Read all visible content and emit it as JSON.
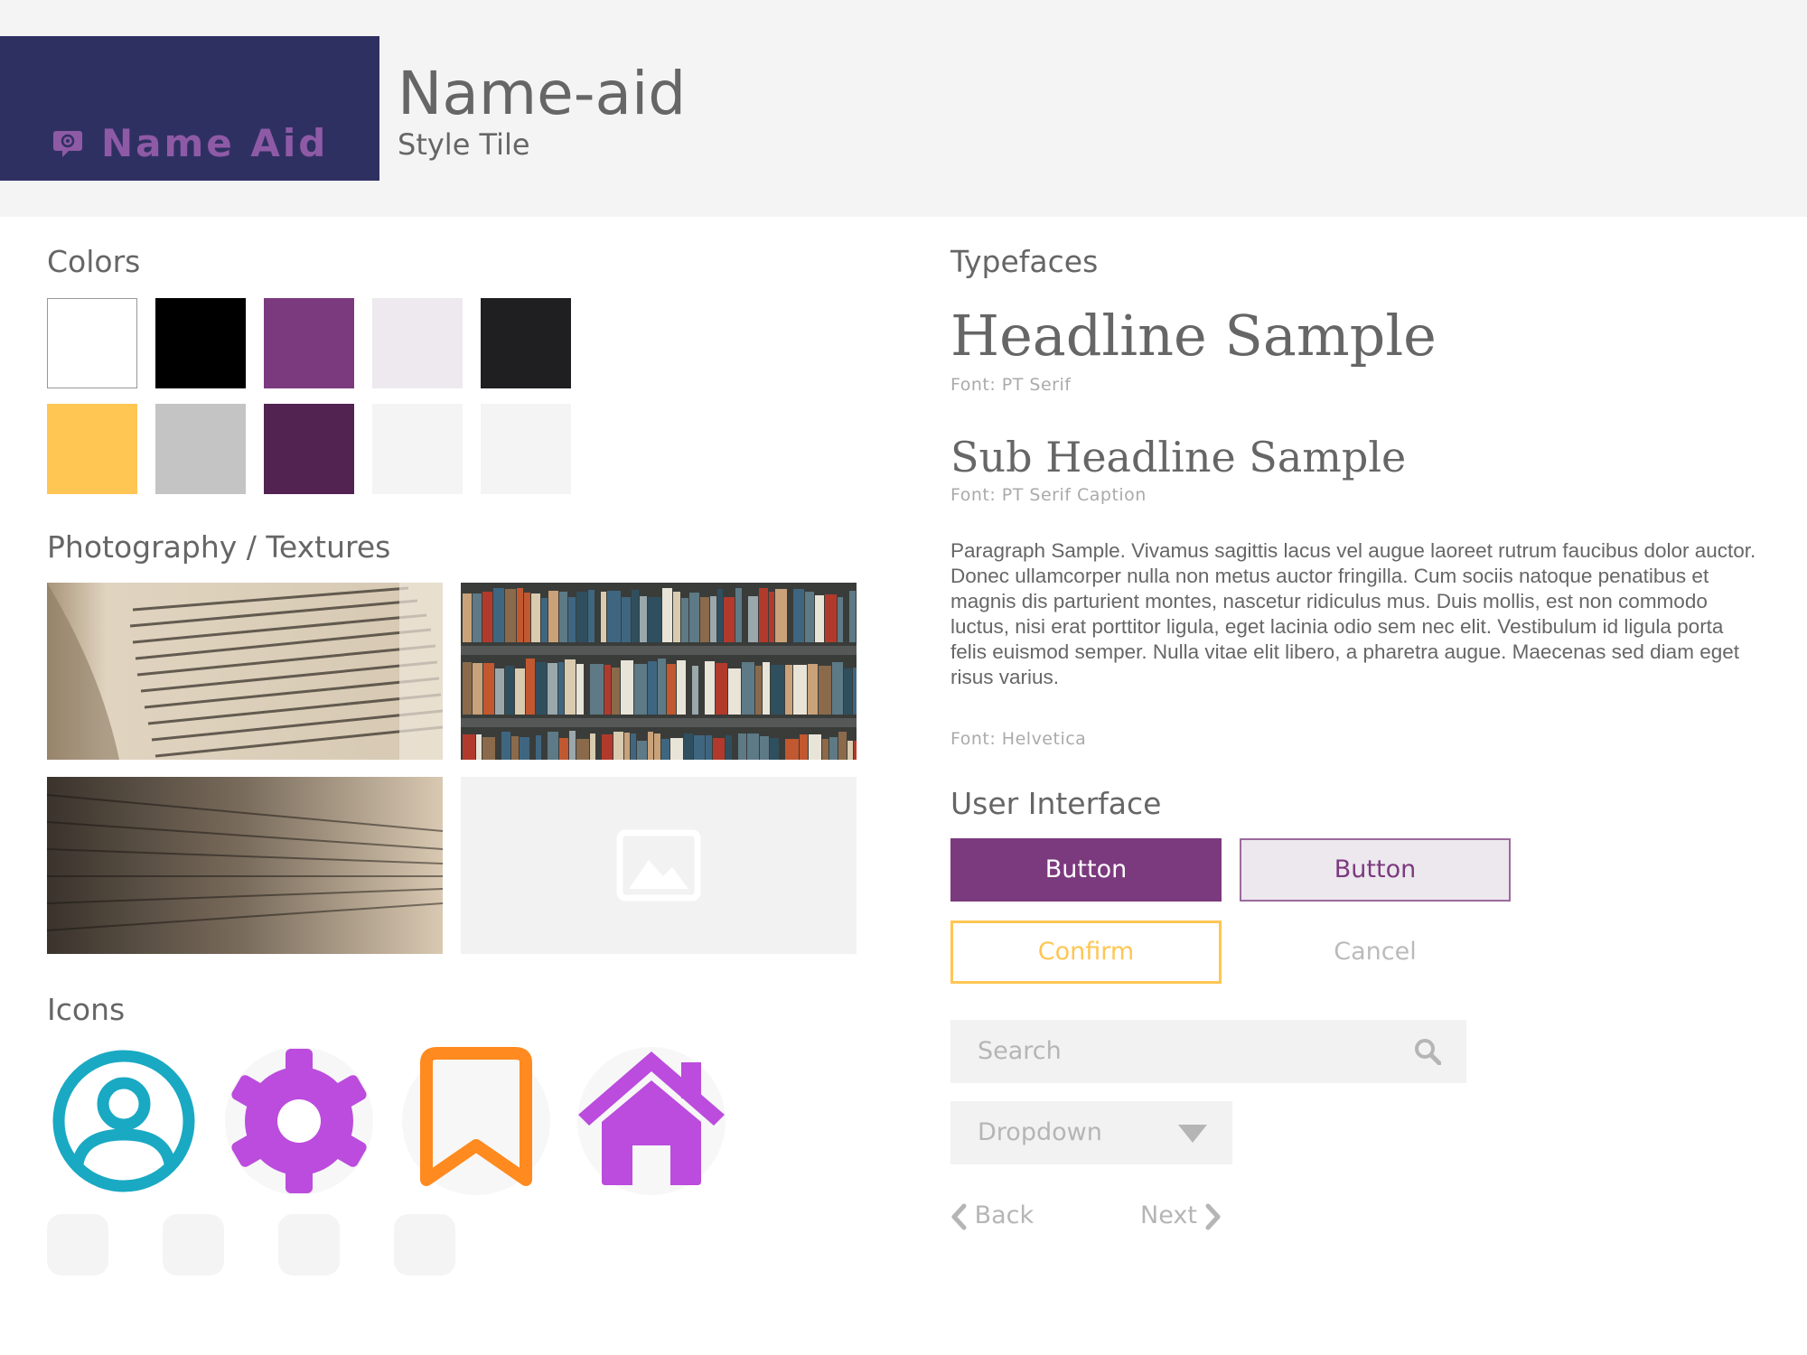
{
  "header": {
    "logo_text": "Name Aid",
    "title": "Name-aid",
    "subtitle": "Style Tile"
  },
  "colors": {
    "title": "Colors",
    "swatches": [
      "#ffffff",
      "#000000",
      "#7c3a7e",
      "#ede9ee",
      "#1f1f21",
      "#ffc654",
      "#c4c4c4",
      "#522251",
      "#f4f4f4",
      "#f4f4f4"
    ]
  },
  "photos": {
    "title": "Photography / Textures"
  },
  "icons": {
    "title": "Icons",
    "items": [
      "user-circle-icon",
      "gear-icon",
      "bookmark-icon",
      "home-icon"
    ],
    "colors": {
      "user": "#19a9c3",
      "gear": "#bb4cdd",
      "bookmark": "#ff8a1f",
      "home": "#bb4cdd"
    }
  },
  "typefaces": {
    "title": "Typefaces",
    "headline": "Headline Sample",
    "headline_font": "Font: PT Serif",
    "subheadline": "Sub Headline Sample",
    "subheadline_font": "Font: PT Serif Caption",
    "paragraph": "Paragraph Sample. Vivamus sagittis lacus vel augue laoreet rutrum faucibus dolor auctor. Donec ullamcorper nulla non metus auctor fringilla. Cum sociis natoque penatibus et magnis dis parturient montes, nascetur ridiculus mus. Duis mollis, est non commodo luctus, nisi erat porttitor ligula, eget lacinia odio sem nec elit. Vestibulum id ligula porta felis euismod semper. Nulla vitae elit libero, a pharetra augue. Maecenas sed diam eget risus varius.",
    "paragraph_font": "Font: Helvetica"
  },
  "ui": {
    "title": "User Interface",
    "primary_button": "Button",
    "secondary_button": "Button",
    "confirm_button": "Confirm",
    "cancel_button": "Cancel",
    "search_placeholder": "Search",
    "dropdown_label": "Dropdown",
    "back_label": "Back",
    "next_label": "Next"
  }
}
